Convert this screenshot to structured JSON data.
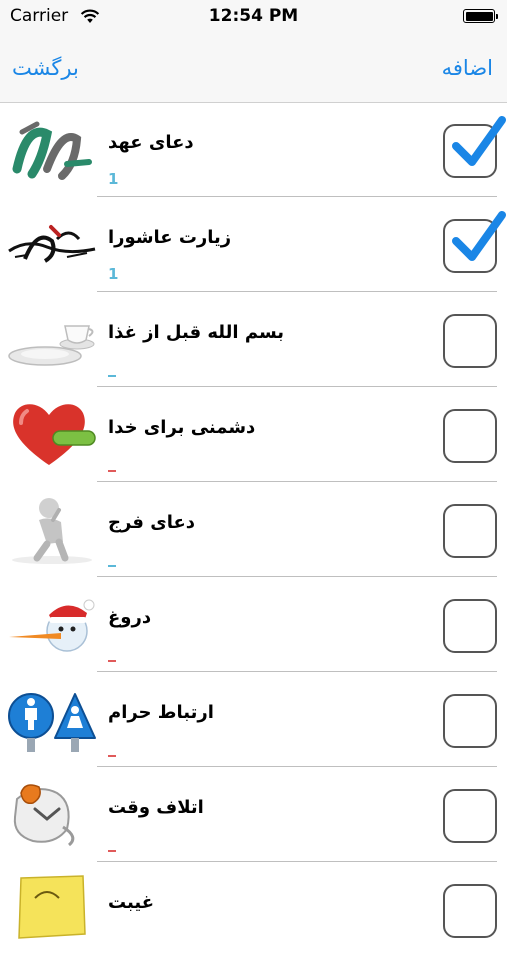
{
  "status_bar": {
    "carrier": "Carrier",
    "time": "12:54 PM"
  },
  "navbar": {
    "back_label": "برگشت",
    "add_label": "اضافه"
  },
  "colors": {
    "accent": "#1a86e6",
    "count_blue": "#5bb8d8",
    "count_red": "#e05a5a"
  },
  "items": [
    {
      "title": "دعای عهد",
      "count": "1",
      "checked": true,
      "icon": "calligraphy-icon"
    },
    {
      "title": "زیارت عاشورا",
      "count": "1",
      "checked": true,
      "icon": "calligraphy-icon"
    },
    {
      "title": "بسم الله قبل از غذا",
      "count": "",
      "checked": false,
      "icon": "plate-cup-icon"
    },
    {
      "title": "دشمنی برای خدا",
      "count": "",
      "checked": false,
      "icon": "heart-minus-icon"
    },
    {
      "title": "دعای فرج",
      "count": "",
      "checked": false,
      "icon": "praying-figure-icon"
    },
    {
      "title": "دروغ",
      "count": "",
      "checked": false,
      "icon": "snowman-icon"
    },
    {
      "title": "ارتباط حرام",
      "count": "",
      "checked": false,
      "icon": "man-woman-signs-icon"
    },
    {
      "title": "اتلاف وقت",
      "count": "",
      "checked": false,
      "icon": "clock-icon"
    },
    {
      "title": "غیبت",
      "count": "",
      "checked": false,
      "icon": "sticky-note-icon"
    }
  ]
}
